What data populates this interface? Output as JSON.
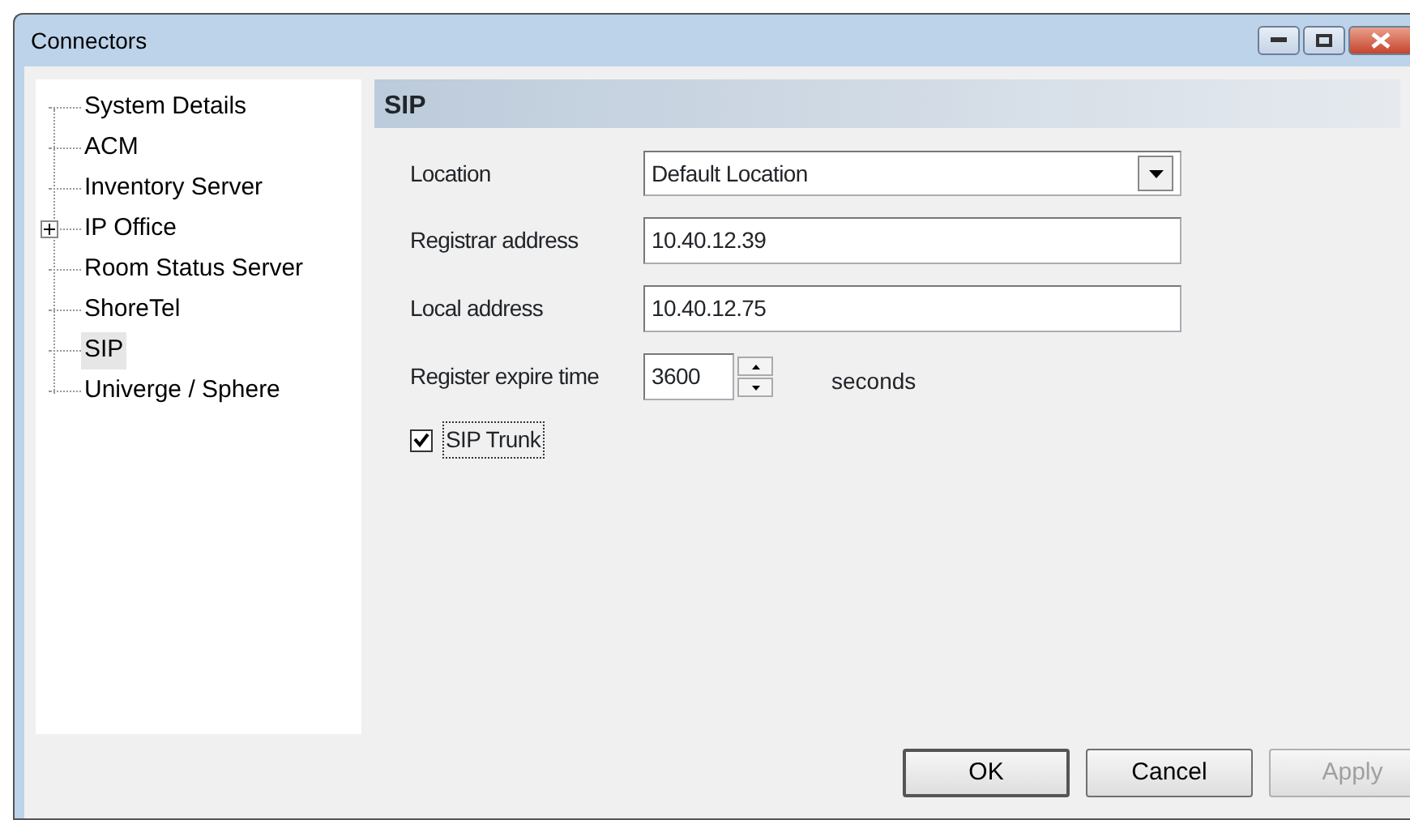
{
  "window": {
    "title": "Connectors"
  },
  "tree": [
    {
      "label": "System Details",
      "selected": false
    },
    {
      "label": "ACM",
      "selected": false
    },
    {
      "label": "Inventory Server",
      "selected": false
    },
    {
      "label": "IP Office",
      "selected": false,
      "expanded": false
    },
    {
      "label": "Room Status Server",
      "selected": false
    },
    {
      "label": "ShoreTel",
      "selected": false
    },
    {
      "label": "SIP",
      "selected": true
    },
    {
      "label": "Univerge / Sphere",
      "selected": false
    }
  ],
  "panel": {
    "title": "SIP"
  },
  "fields": [
    {
      "kind": "dropdown",
      "label": "Location",
      "value": "Default Location"
    },
    {
      "kind": "text",
      "label": "Registrar address",
      "value": "10.40.12.39"
    },
    {
      "kind": "text",
      "label": "Local address",
      "value": "10.40.12.75"
    },
    {
      "kind": "spin",
      "label": "Register expire time",
      "value": "3600",
      "unit": "seconds"
    }
  ],
  "checkbox": {
    "label": "SIP Trunk",
    "checked": true
  },
  "buttons": [
    {
      "label": "OK",
      "disabled": false
    },
    {
      "label": "Cancel",
      "disabled": false
    },
    {
      "label": "Apply",
      "disabled": true
    }
  ]
}
